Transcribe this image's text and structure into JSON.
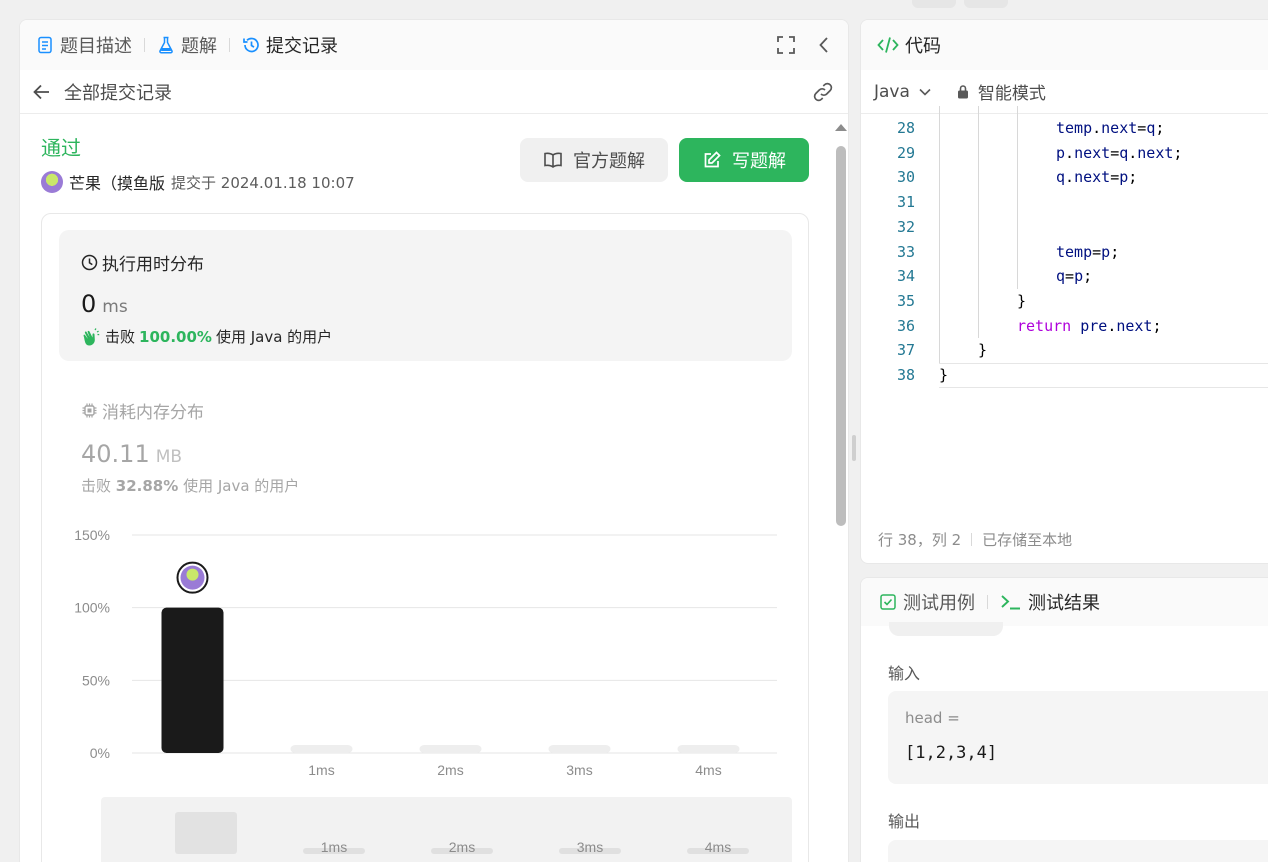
{
  "left_tabs": [
    {
      "label": "题目描述",
      "icon": "document-icon"
    },
    {
      "label": "题解",
      "icon": "flask-icon"
    },
    {
      "label": "提交记录",
      "icon": "history-icon"
    }
  ],
  "subbar": {
    "title": "全部提交记录"
  },
  "submission": {
    "status": "通过",
    "user": "芒果（摸鱼版",
    "submitted_at": "提交于 2024.01.18 10:07"
  },
  "buttons": {
    "official": "官方题解",
    "write": "写题解"
  },
  "runtime": {
    "title": "执行用时分布",
    "value": "0",
    "unit": "ms",
    "beat_prefix": "击败",
    "beat_pct": "100.00%",
    "beat_suffix": "使用 Java 的用户"
  },
  "memory": {
    "title": "消耗内存分布",
    "value": "40.11",
    "unit": "MB",
    "beat_prefix": "击败",
    "beat_pct": "32.88%",
    "beat_suffix": "使用 Java 的用户"
  },
  "chart_data": {
    "type": "bar",
    "categories": [
      "0ms",
      "1ms",
      "2ms",
      "3ms",
      "4ms"
    ],
    "category_labels_shown": [
      "",
      "1ms",
      "2ms",
      "3ms",
      "4ms"
    ],
    "values": [
      100,
      0,
      0,
      0,
      0
    ],
    "y_ticks": [
      "0%",
      "50%",
      "100%",
      "150%"
    ],
    "ylim": [
      0,
      150
    ],
    "highlight_index": 0,
    "overview_labels": [
      "1ms",
      "2ms",
      "3ms",
      "4ms"
    ],
    "colors": {
      "highlight": "#1a1a1a",
      "other": "#eeeeee",
      "grid": "#e6e6e6"
    }
  },
  "code_panel": {
    "title": "代码",
    "language": "Java",
    "mode": "智能模式",
    "status_position": "行 38，列 2",
    "status_saved": "已存储至本地",
    "lines": [
      {
        "n": "28",
        "indent": 3,
        "text": "temp.next=q;"
      },
      {
        "n": "29",
        "indent": 3,
        "text": "p.next=q.next;"
      },
      {
        "n": "30",
        "indent": 3,
        "text": "q.next=p;"
      },
      {
        "n": "31",
        "indent": 3,
        "text": ""
      },
      {
        "n": "32",
        "indent": 3,
        "text": ""
      },
      {
        "n": "33",
        "indent": 3,
        "text": "temp=p;"
      },
      {
        "n": "34",
        "indent": 3,
        "text": "q=p;"
      },
      {
        "n": "35",
        "indent": 2,
        "text": "}"
      },
      {
        "n": "36",
        "indent": 2,
        "text": "return pre.next;"
      },
      {
        "n": "37",
        "indent": 1,
        "text": "}"
      },
      {
        "n": "38",
        "indent": 0,
        "text": "}"
      }
    ]
  },
  "test_panel": {
    "tab_cases": "测试用例",
    "tab_results": "测试结果",
    "input_label": "输入",
    "input_var": "head =",
    "input_value": "[1,2,3,4]",
    "output_label": "输出"
  },
  "colors": {
    "accent": "#2db55d",
    "blue": "#1a90ff"
  }
}
